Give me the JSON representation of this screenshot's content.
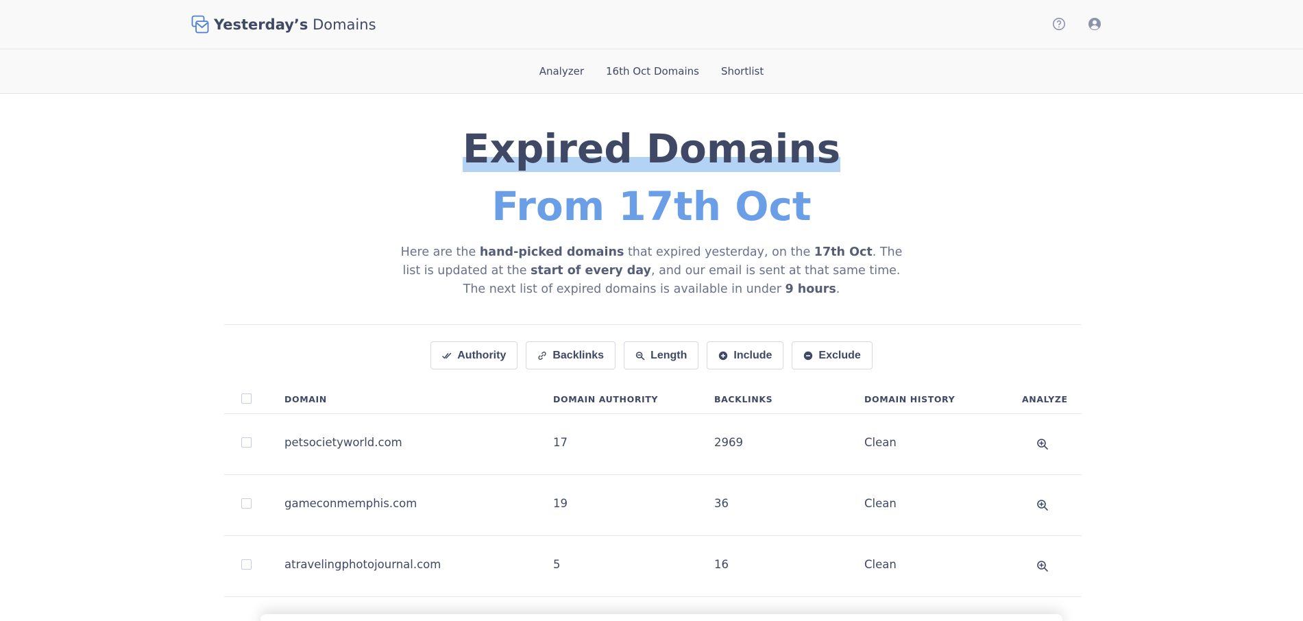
{
  "brand": {
    "name_bold": "Yesterday’s",
    "name_light": "Domains"
  },
  "header": {
    "icons": [
      "help-icon",
      "user-icon"
    ]
  },
  "nav": {
    "items": [
      "Analyzer",
      "16th Oct Domains",
      "Shortlist"
    ]
  },
  "hero": {
    "title": "Expired Domains",
    "subtitle": "From 17th Oct",
    "desc": {
      "p1": "Here are the ",
      "b1": "hand-picked domains",
      "p2": " that expired yesterday, on the ",
      "b2": "17th Oct",
      "p3": ". The list is updated at the ",
      "b3": "start of every day",
      "p4": ", and our email is sent at that same time. The next list of expired domains is available in under ",
      "b4": "9 hours",
      "p5": "."
    }
  },
  "filters": [
    {
      "label": "Authority",
      "icon": "double-check-icon"
    },
    {
      "label": "Backlinks",
      "icon": "link-icon"
    },
    {
      "label": "Length",
      "icon": "ruler-search-icon"
    },
    {
      "label": "Include",
      "icon": "plus-circle-icon"
    },
    {
      "label": "Exclude",
      "icon": "minus-circle-icon"
    }
  ],
  "table": {
    "headers": {
      "domain": "DOMAIN",
      "authority": "DOMAIN AUTHORITY",
      "backlinks": "BACKLINKS",
      "history": "DOMAIN HISTORY",
      "analyze": "ANALYZE"
    },
    "rows": [
      {
        "domain": "petsocietyworld.com",
        "authority": "17",
        "backlinks": "2969",
        "history": "Clean"
      },
      {
        "domain": "gameconmemphis.com",
        "authority": "19",
        "backlinks": "36",
        "history": "Clean"
      },
      {
        "domain": "atravelingphotojournal.com",
        "authority": "5",
        "backlinks": "16",
        "history": "Clean"
      }
    ]
  },
  "colors": {
    "text": "#3f4864",
    "accent": "#6a9ee6",
    "highlight": "#b4d3f4"
  }
}
